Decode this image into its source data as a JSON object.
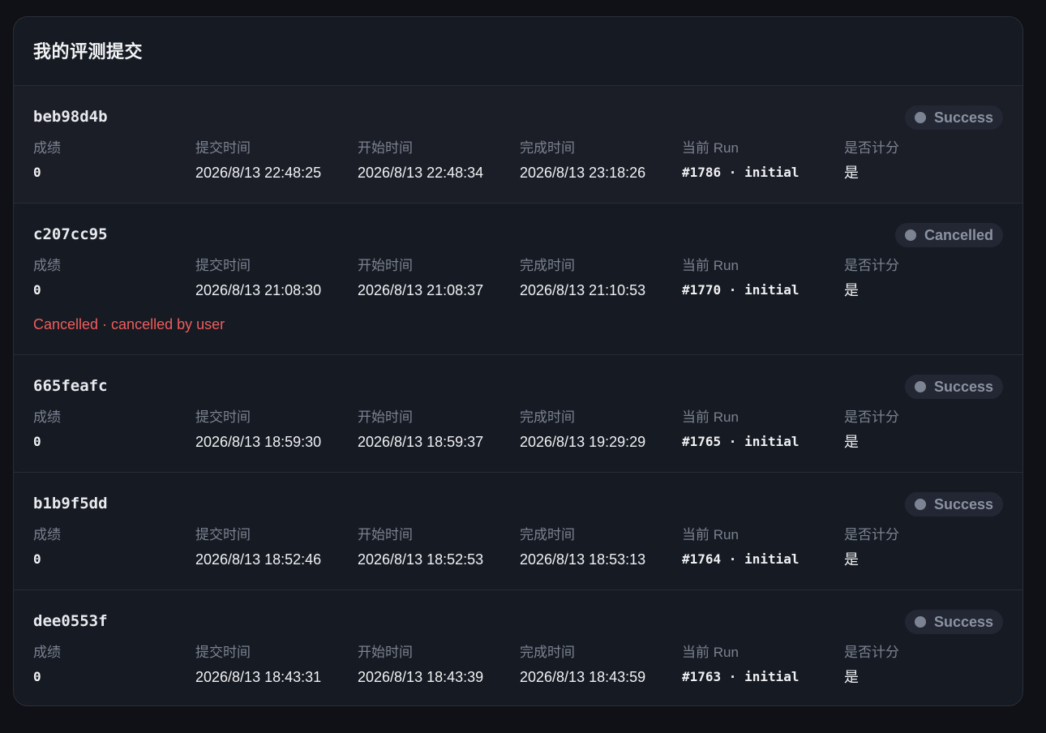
{
  "header": {
    "title": "我的评测提交"
  },
  "columns": {
    "score": "成绩",
    "submit_time": "提交时间",
    "start_time": "开始时间",
    "finish_time": "完成时间",
    "current_run": "当前 Run",
    "scored": "是否计分"
  },
  "submissions": [
    {
      "id": "beb98d4b",
      "status": "Success",
      "score": "0",
      "submit_time": "2026/8/13 22:48:25",
      "start_time": "2026/8/13 22:48:34",
      "finish_time": "2026/8/13 23:18:26",
      "run": "#1786 · initial",
      "scored": "是"
    },
    {
      "id": "c207cc95",
      "status": "Cancelled",
      "score": "0",
      "submit_time": "2026/8/13 21:08:30",
      "start_time": "2026/8/13 21:08:37",
      "finish_time": "2026/8/13 21:10:53",
      "run": "#1770 · initial",
      "scored": "是",
      "error": "Cancelled · cancelled by user"
    },
    {
      "id": "665feafc",
      "status": "Success",
      "score": "0",
      "submit_time": "2026/8/13 18:59:30",
      "start_time": "2026/8/13 18:59:37",
      "finish_time": "2026/8/13 19:29:29",
      "run": "#1765 · initial",
      "scored": "是"
    },
    {
      "id": "b1b9f5dd",
      "status": "Success",
      "score": "0",
      "submit_time": "2026/8/13 18:52:46",
      "start_time": "2026/8/13 18:52:53",
      "finish_time": "2026/8/13 18:53:13",
      "run": "#1764 · initial",
      "scored": "是"
    },
    {
      "id": "dee0553f",
      "status": "Success",
      "score": "0",
      "submit_time": "2026/8/13 18:43:31",
      "start_time": "2026/8/13 18:43:39",
      "finish_time": "2026/8/13 18:43:59",
      "run": "#1763 · initial",
      "scored": "是"
    }
  ],
  "colors": {
    "background": "#101116",
    "card": "#161a22",
    "status_badge": "#232733",
    "status_text": "#8b92a1",
    "error_text": "#ee5d5d"
  }
}
